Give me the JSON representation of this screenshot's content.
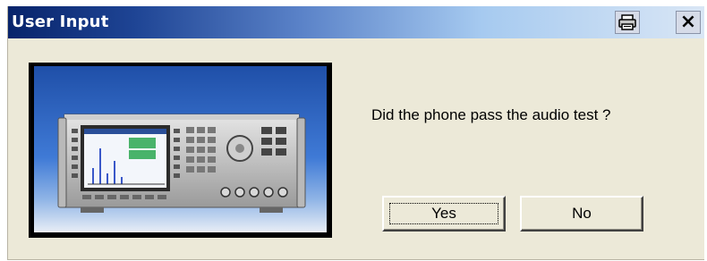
{
  "window": {
    "title": "User Input",
    "print_icon": "printer-icon",
    "close_label": "×"
  },
  "image": {
    "icon": "test-instrument-photo"
  },
  "dialog": {
    "question": "Did the phone pass the audio test ?",
    "yes_label": "Yes",
    "no_label": "No"
  },
  "colors": {
    "titlebar_start": "#08246b",
    "titlebar_end": "#d9e6f5",
    "dialog_bg": "#ece9d8"
  }
}
